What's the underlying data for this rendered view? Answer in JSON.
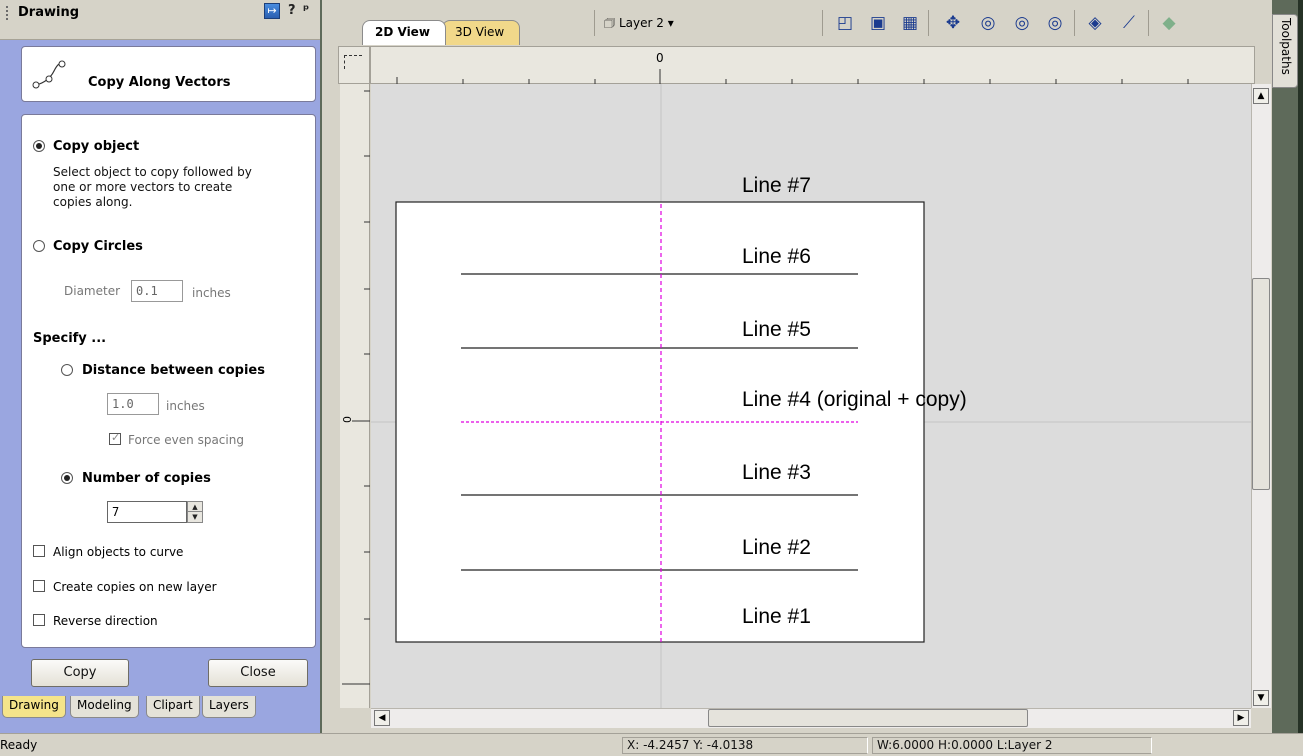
{
  "left_panel": {
    "title": "Drawing",
    "header_buttons": {
      "help": "?",
      "pin": "ᵖ"
    },
    "tool": {
      "name": "Copy Along Vectors",
      "icon": "copy-along-vectors-icon"
    },
    "copy_object": {
      "label": "Copy object",
      "selected": true,
      "description_lines": [
        "Select object to copy followed by",
        "one or more vectors to create",
        "copies along."
      ]
    },
    "copy_circles": {
      "label": "Copy Circles",
      "selected": false,
      "diameter_label": "Diameter",
      "diameter_value": "0.1",
      "diameter_unit": "inches"
    },
    "specify_label": "Specify ...",
    "distance": {
      "label": "Distance between copies",
      "selected": false,
      "value": "1.0",
      "unit": "inches",
      "force_even_label": "Force even spacing",
      "force_even_checked": true
    },
    "number_of_copies": {
      "label": "Number of copies",
      "selected": true,
      "value": "7"
    },
    "checkboxes": [
      {
        "label": "Align objects to curve",
        "checked": false
      },
      {
        "label": "Create copies on new layer",
        "checked": false
      },
      {
        "label": "Reverse direction",
        "checked": false
      }
    ],
    "buttons": {
      "copy": "Copy",
      "close": "Close"
    },
    "tabs": [
      "Drawing",
      "Modeling",
      "Clipart",
      "Layers"
    ],
    "active_tab": "Drawing"
  },
  "toolbar": {
    "tabs": [
      "2D View",
      "3D View"
    ],
    "active_tab": "2D View",
    "layer": "Layer 2",
    "icons": [
      "set-size-icon",
      "bounding-box-icon",
      "grid-icon",
      "pan-icon",
      "zoom-box-icon",
      "zoom-fit-icon",
      "zoom-selection-icon",
      "vector-view-icon",
      "vector-toggle-icon",
      "model-view-icon"
    ]
  },
  "ruler": {
    "top_zero": "0",
    "left_zero": "0"
  },
  "canvas": {
    "labels": [
      "Line #7",
      "Line #6",
      "Line #5",
      "Line #4 (original + copy)",
      "Line #3",
      "Line #2",
      "Line #1"
    ]
  },
  "side_tab": "Toolpaths",
  "status": {
    "left": "Ready",
    "coords": "X: -4.2457 Y: -4.0138",
    "selection": "W:6.0000  H:0.0000  L:Layer 2"
  },
  "colors": {
    "panel_blue": "#9aa6e0",
    "tab_active": "#f5e48a",
    "selection_magenta": "#e000e0"
  }
}
